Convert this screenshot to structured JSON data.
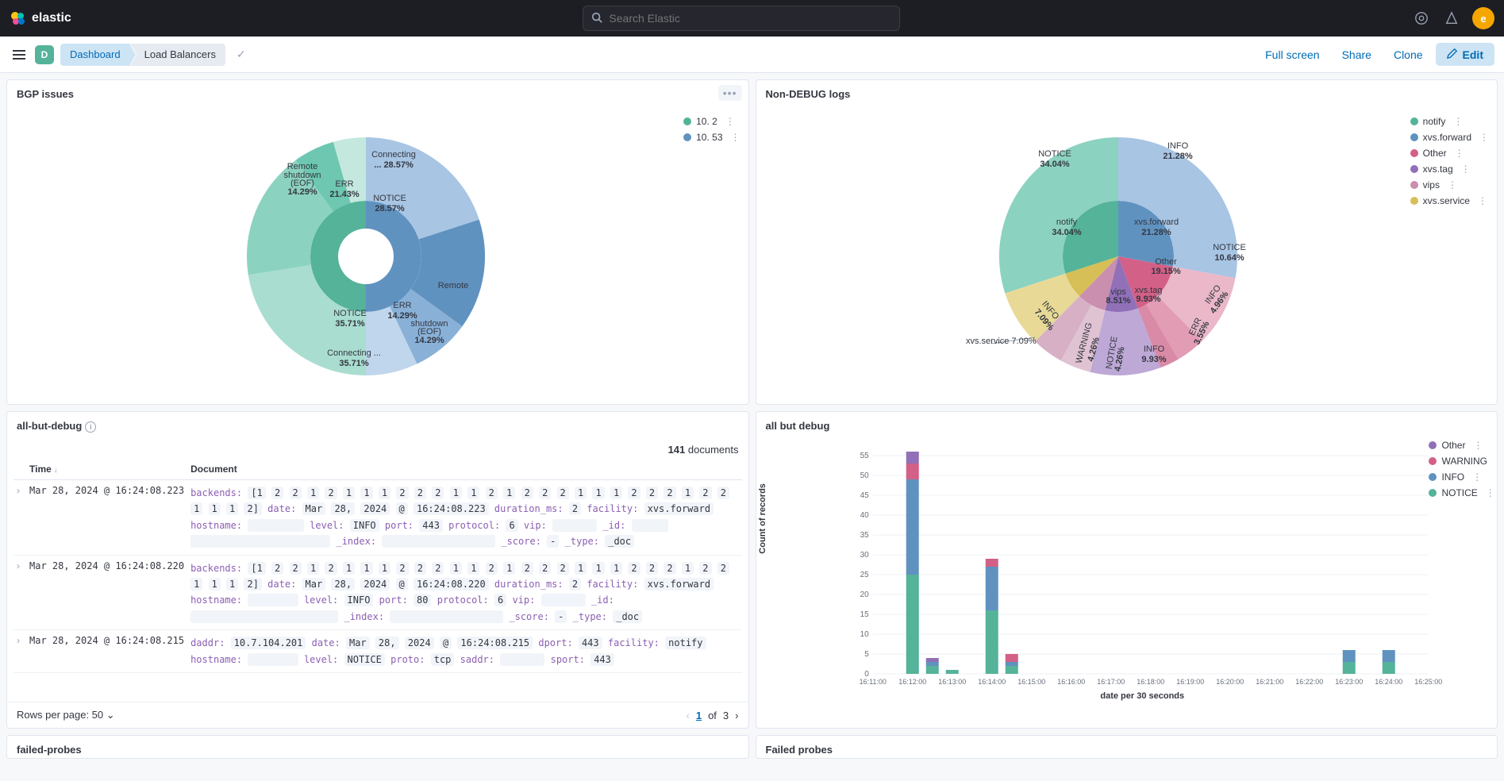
{
  "topbar": {
    "brand": "elastic",
    "search_placeholder": "Search Elastic",
    "avatar_letter": "e"
  },
  "subbar": {
    "space_letter": "D",
    "breadcrumbs": [
      "Dashboard",
      "Load Balancers"
    ],
    "actions": {
      "fullscreen": "Full screen",
      "share": "Share",
      "clone": "Clone",
      "edit": "Edit"
    }
  },
  "panels": {
    "bgp": {
      "title": "BGP issues",
      "legend": [
        {
          "label": "10.           2",
          "color": "#54b399"
        },
        {
          "label": "10.           53",
          "color": "#6092c0"
        }
      ]
    },
    "nondebug": {
      "title": "Non-DEBUG logs",
      "legend": [
        {
          "label": "notify",
          "color": "#54b399"
        },
        {
          "label": "xvs.forward",
          "color": "#6092c0"
        },
        {
          "label": "Other",
          "color": "#d36086"
        },
        {
          "label": "xvs.tag",
          "color": "#9170b8"
        },
        {
          "label": "vips",
          "color": "#ca8eae"
        },
        {
          "label": "xvs.service",
          "color": "#d6bf57"
        }
      ]
    },
    "allbutdebug_table": {
      "title": "all-but-debug",
      "doc_count_num": "141",
      "doc_count_word": "documents",
      "columns": {
        "time": "Time",
        "document": "Document"
      },
      "rows": [
        {
          "time": "Mar 28, 2024 @ 16:24:08.223",
          "doc": "backends: [1 2 2 1 2 1 1 1 2 2 2 1 1 2 1 2 2 2 1 1 1 2 2 2 1 2 2 1 1 1 2] date: Mar 28, 2024 @ 16:24:08.223 duration_ms: 2 facility: xvs.forward hostname: ▇▇▇▇▇▇0 level: INFO port: 443 protocol: 6 vip: ▇▇▇▇▇ _id: ▇▇▇▇-▇▇▇-1711642436578081386 _index: ▇▇▇▇loadbalancers _score: - _type: _doc"
        },
        {
          "time": "Mar 28, 2024 @ 16:24:08.220",
          "doc": "backends: [1 2 2 1 2 1 1 1 2 2 2 1 1 2 1 2 2 2 1 1 1 2 2 2 1 2 2 1 1 1 2] date: Mar 28, 2024 @ 16:24:08.220 duration_ms: 2 facility: xvs.forward hostname: ▇▇▇▇▇▇ level: INFO port: 80 protocol: 6 vip: ▇▇▇▇▇ _id: ▇▇▇▇1711642436578081385 _index: ▇▇▇▇loadbalancers _score: - _type: _doc"
        },
        {
          "time": "Mar 28, 2024 @ 16:24:08.215",
          "doc": "daddr: 10.7.104.201 date: Mar 28, 2024 @ 16:24:08.215 dport: 443 facility: notify hostname: ▇▇▇▇▇▇ level: NOTICE proto: tcp saddr: ▇▇▇▇▇ sport: 443"
        }
      ],
      "pager": {
        "rows_per_page": "Rows per page: 50",
        "current": "1",
        "of_word": "of",
        "total": "3"
      }
    },
    "allbutdebug_chart": {
      "title": "all but debug",
      "legend": [
        {
          "label": "Other",
          "color": "#9170b8"
        },
        {
          "label": "WARNING",
          "color": "#d36086"
        },
        {
          "label": "INFO",
          "color": "#6092c0"
        },
        {
          "label": "NOTICE",
          "color": "#54b399"
        }
      ],
      "ylabel": "Count of records",
      "xlabel": "date per 30 seconds"
    },
    "failed_probes_left": {
      "title": "failed-probes"
    },
    "failed_probes_right": {
      "title": "Failed probes"
    }
  },
  "chart_data": [
    {
      "id": "bgp_pie",
      "type": "pie",
      "title": "BGP issues",
      "nested": true,
      "inner_ring": {
        "series_name": "host",
        "slices": [
          {
            "label": "10.x.x.2",
            "value": 0.5,
            "color": "#54b399"
          },
          {
            "label": "10.x.x.53",
            "value": 0.5,
            "color": "#6092c0"
          }
        ]
      },
      "outer_ring": {
        "series_name": "event",
        "slices": [
          {
            "parent": "10.x.x.53",
            "label": "Connecting ...",
            "percent": 28.57,
            "color": "#a8c5e3"
          },
          {
            "parent": "10.x.x.53",
            "label": "ERR",
            "percent": 14.29,
            "color": "#89b1d8"
          },
          {
            "parent": "10.x.x.53",
            "label": "Remote shutdown (EOF)",
            "percent": 14.29,
            "color": "#c0d6ec"
          },
          {
            "parent": "10.x.x.53",
            "label": "NOTICE",
            "percent": 28.57,
            "color": "#6092c0"
          },
          {
            "parent": "10.x.x.2",
            "label": "NOTICE",
            "percent": 35.71,
            "color": "#8cd2c0"
          },
          {
            "parent": "10.x.x.2",
            "label": "Connecting ...",
            "percent": 35.71,
            "color": "#a9ddd0"
          },
          {
            "parent": "10.x.x.2",
            "label": "ERR",
            "percent": 21.43,
            "color": "#6ec7b0"
          },
          {
            "parent": "10.x.x.2",
            "label": "Remote shutdown (EOF)",
            "percent": 14.29,
            "color": "#c4e8de"
          }
        ]
      }
    },
    {
      "id": "nondebug_pie",
      "type": "pie",
      "title": "Non-DEBUG logs",
      "nested": true,
      "inner_ring": {
        "series_name": "facility",
        "slices": [
          {
            "label": "notify",
            "percent": 34.04,
            "color": "#54b399"
          },
          {
            "label": "xvs.forward",
            "percent": 21.28,
            "color": "#6092c0"
          },
          {
            "label": "Other",
            "percent": 19.15,
            "color": "#d36086"
          },
          {
            "label": "xvs.tag",
            "percent": 9.93,
            "color": "#9170b8"
          },
          {
            "label": "vips",
            "percent": 8.51,
            "color": "#ca8eae"
          },
          {
            "label": "xvs.service",
            "percent": 7.09,
            "color": "#d6bf57"
          }
        ]
      },
      "outer_ring": {
        "series_name": "level",
        "slices": [
          {
            "parent": "notify",
            "label": "NOTICE",
            "percent": 34.04,
            "color": "#8cd2c0"
          },
          {
            "parent": "xvs.forward",
            "label": "INFO",
            "percent": 21.28,
            "color": "#a8c5e3"
          },
          {
            "parent": "Other",
            "label": "NOTICE",
            "percent": 10.64,
            "color": "#eab8c8"
          },
          {
            "parent": "Other",
            "label": "INFO",
            "percent": 4.96,
            "color": "#e29cb4"
          },
          {
            "parent": "Other",
            "label": "ERR",
            "percent": 3.55,
            "color": "#d98aa6"
          },
          {
            "parent": "xvs.tag",
            "label": "INFO",
            "percent": 9.93,
            "color": "#bda8d6"
          },
          {
            "parent": "vips",
            "label": "NOTICE",
            "percent": 4.26,
            "color": "#e0c3d3"
          },
          {
            "parent": "vips",
            "label": "WARNING",
            "percent": 4.26,
            "color": "#d7b0c5"
          },
          {
            "parent": "xvs.service",
            "label": "INFO",
            "percent": 7.09,
            "color": "#e8da96"
          }
        ]
      },
      "callout": "xvs.service  7.09%"
    },
    {
      "id": "all_but_debug_bar",
      "type": "bar",
      "stacked": true,
      "xlabel": "date per 30 seconds",
      "ylabel": "Count of records",
      "ylim": [
        0,
        55
      ],
      "x_categories": [
        "16:11:00",
        "16:12:00",
        "16:13:00",
        "16:14:00",
        "16:15:00",
        "16:16:00",
        "16:17:00",
        "16:18:00",
        "16:19:00",
        "16:20:00",
        "16:21:00",
        "16:22:00",
        "16:23:00",
        "16:24:00",
        "16:25:00"
      ],
      "series": [
        {
          "name": "NOTICE",
          "color": "#54b399",
          "values_at": {
            "16:12:00": 25,
            "16:12:30": 2,
            "16:13:00": 1,
            "16:14:00": 16,
            "16:14:30": 2,
            "16:23:00": 3,
            "16:24:00": 3
          }
        },
        {
          "name": "INFO",
          "color": "#6092c0",
          "values_at": {
            "16:12:00": 24,
            "16:12:30": 1,
            "16:14:00": 11,
            "16:14:30": 1,
            "16:23:00": 3,
            "16:24:00": 3
          }
        },
        {
          "name": "WARNING",
          "color": "#d36086",
          "values_at": {
            "16:12:00": 4,
            "16:14:00": 2,
            "16:14:30": 2
          }
        },
        {
          "name": "Other",
          "color": "#9170b8",
          "values_at": {
            "16:12:00": 3,
            "16:12:30": 1
          }
        }
      ]
    }
  ]
}
